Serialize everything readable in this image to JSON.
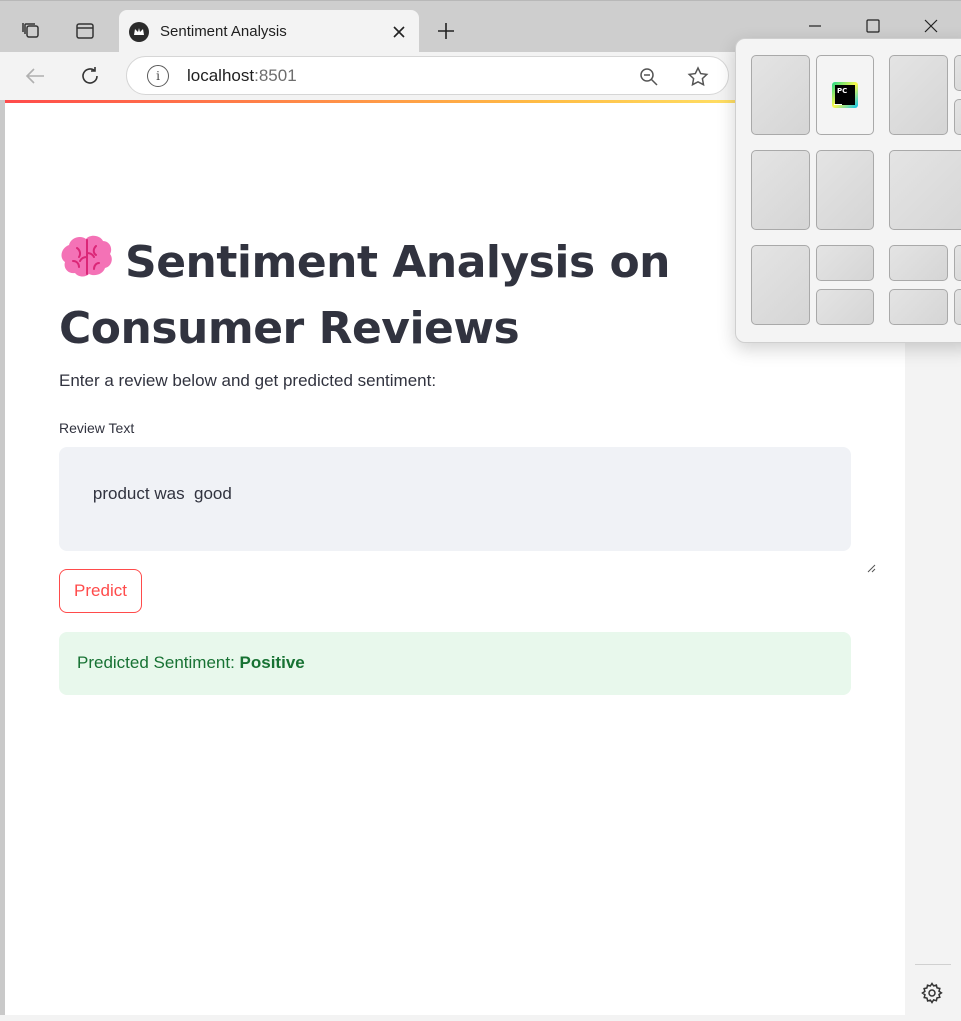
{
  "browser": {
    "tab": {
      "title": "Sentiment Analysis"
    },
    "address": {
      "host": "localhost",
      "port": ":8501"
    }
  },
  "app": {
    "title": "Sentiment Analysis on Consumer Reviews",
    "title_emoji": "brain-icon",
    "subtitle": "Enter a review below and get predicted sentiment:",
    "review_field": {
      "label": "Review Text",
      "value": "product was  good"
    },
    "predict_button": {
      "label": "Predict"
    },
    "result": {
      "prefix": "Predicted Sentiment: ",
      "value": "Positive"
    }
  },
  "snap_flyout": {
    "app_icon": {
      "label": "PC",
      "name": "pycharm-icon"
    }
  },
  "colors": {
    "primary": "#ff4b4b",
    "success_bg": "#e8f8ec",
    "success_text": "#177233",
    "input_bg": "#f0f2f6",
    "text": "#31333f"
  }
}
